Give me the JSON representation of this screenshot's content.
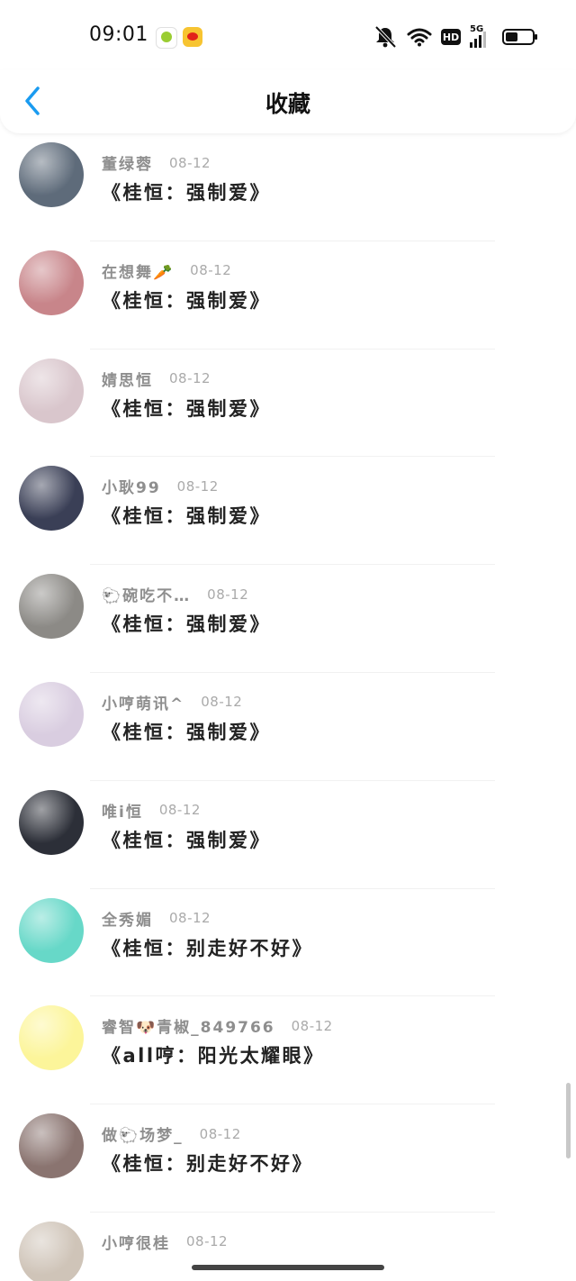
{
  "status_bar": {
    "time": "09:01",
    "icons": [
      "mute-bell-icon",
      "wifi-icon",
      "hd-icon",
      "5g-signal-icon",
      "battery-icon"
    ],
    "network_label": "5G",
    "hd_label": "HD",
    "battery_level": 0.45
  },
  "header": {
    "title": "收藏",
    "back_icon": "chevron-left-icon",
    "accent_color": "#1a9bf0"
  },
  "items": [
    {
      "user": "董绿蓉",
      "date": "08-12",
      "title": "《桂恒：强制爱》",
      "avatar_color": "#5e6b7a"
    },
    {
      "user": "在想舞🥕",
      "date": "08-12",
      "title": "《桂恒：强制爱》",
      "avatar_color": "#c8858a"
    },
    {
      "user": "婧思恒",
      "date": "08-12",
      "title": "《桂恒：强制爱》",
      "avatar_color": "#d9c6cc"
    },
    {
      "user": "小耿99",
      "date": "08-12",
      "title": "《桂恒：强制爱》",
      "avatar_color": "#3a3f56"
    },
    {
      "user": "🐑碗吃不…",
      "date": "08-12",
      "title": "《桂恒：强制爱》",
      "avatar_color": "#8c8a86"
    },
    {
      "user": "小哼萌讯^",
      "date": "08-12",
      "title": "《桂恒：强制爱》",
      "avatar_color": "#d9cde0"
    },
    {
      "user": "唯i恒",
      "date": "08-12",
      "title": "《桂恒：强制爱》",
      "avatar_color": "#2c2f38"
    },
    {
      "user": "全秀媚",
      "date": "08-12",
      "title": "《桂恒：别走好不好》",
      "avatar_color": "#67d8c8"
    },
    {
      "user": "睿智🐶青椒_849766",
      "date": "08-12",
      "title": "《all哼：阳光太耀眼》",
      "avatar_color": "#fcf59a"
    },
    {
      "user": "做🐑场梦_",
      "date": "08-12",
      "title": "《桂恒：别走好不好》",
      "avatar_color": "#8a7470"
    },
    {
      "user": "小哼很桂",
      "date": "08-12",
      "title": "",
      "avatar_color": "#cfc4b8"
    }
  ]
}
